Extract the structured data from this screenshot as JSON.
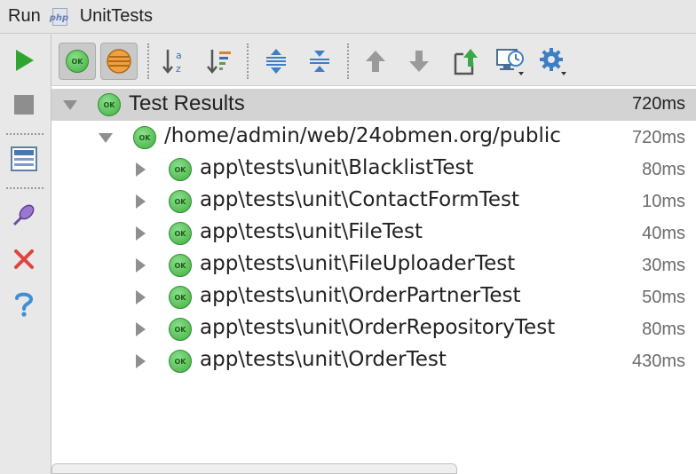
{
  "window": {
    "prefix": "Run",
    "icon": "php-file-icon",
    "php_label": "php",
    "title": "UnitTests"
  },
  "left_toolbar": [
    {
      "name": "rerun",
      "icon": "play-icon"
    },
    {
      "name": "stop",
      "icon": "stop-icon"
    },
    {
      "name": "layout",
      "icon": "layout-icon"
    },
    {
      "name": "pin",
      "icon": "pin-icon"
    },
    {
      "name": "close",
      "icon": "close-icon"
    },
    {
      "name": "help",
      "icon": "help-icon"
    }
  ],
  "top_toolbar": [
    {
      "name": "show-passed",
      "icon": "ok-filter-icon",
      "pressed": true
    },
    {
      "name": "show-ignored",
      "icon": "ignored-filter-icon",
      "pressed": true
    },
    {
      "name": "sort-alpha",
      "icon": "sort-alphabetically-icon"
    },
    {
      "name": "sort-duration",
      "icon": "sort-by-duration-icon"
    },
    {
      "name": "expand-all",
      "icon": "expand-all-icon"
    },
    {
      "name": "collapse-all",
      "icon": "collapse-all-icon"
    },
    {
      "name": "prev-failed",
      "icon": "arrow-up-icon"
    },
    {
      "name": "next-failed",
      "icon": "arrow-down-icon"
    },
    {
      "name": "export",
      "icon": "export-icon"
    },
    {
      "name": "history",
      "icon": "test-history-icon"
    },
    {
      "name": "settings",
      "icon": "gear-icon"
    }
  ],
  "ok_badge": "OK",
  "results": {
    "root": {
      "label": "Test Results",
      "time": "720ms",
      "status": "passed"
    },
    "suite": {
      "label": "/home/admin/web/24obmen.org/public",
      "time": "720ms",
      "status": "passed"
    },
    "tests": [
      {
        "label": "app\\tests\\unit\\BlacklistTest",
        "time": "80ms",
        "status": "passed"
      },
      {
        "label": "app\\tests\\unit\\ContactFormTest",
        "time": "10ms",
        "status": "passed"
      },
      {
        "label": "app\\tests\\unit\\FileTest",
        "time": "40ms",
        "status": "passed"
      },
      {
        "label": "app\\tests\\unit\\FileUploaderTest",
        "time": "30ms",
        "status": "passed"
      },
      {
        "label": "app\\tests\\unit\\OrderPartnerTest",
        "time": "50ms",
        "status": "passed"
      },
      {
        "label": "app\\tests\\unit\\OrderRepositoryTest",
        "time": "80ms",
        "status": "passed"
      },
      {
        "label": "app\\tests\\unit\\OrderTest",
        "time": "430ms",
        "status": "passed"
      }
    ]
  },
  "colors": {
    "ok_green": "#3fae3f",
    "run_green": "#2fa52f",
    "stop_gray": "#8e8e8e",
    "close_red": "#e0443e",
    "help_blue": "#3d8fd6",
    "root_row_bg": "#d3d3d3"
  }
}
